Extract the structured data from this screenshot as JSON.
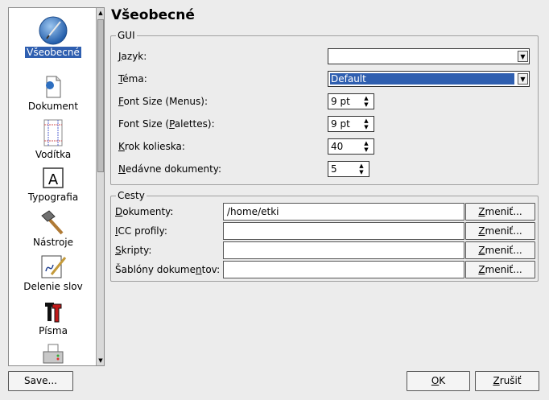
{
  "sidebar": {
    "items": [
      {
        "label": "Všeobecné",
        "icon": "globe-pen-icon"
      },
      {
        "label": "Dokument",
        "icon": "document-icon"
      },
      {
        "label": "Vodítka",
        "icon": "guides-icon"
      },
      {
        "label": "Typografia",
        "icon": "typography-icon"
      },
      {
        "label": "Nástroje",
        "icon": "hammer-icon"
      },
      {
        "label": "Delenie slov",
        "icon": "hyphenation-icon"
      },
      {
        "label": "Písma",
        "icon": "fonts-icon"
      },
      {
        "label": "",
        "icon": "printer-icon"
      }
    ]
  },
  "page": {
    "title": "Všeobecné"
  },
  "gui": {
    "legend": "GUI",
    "language": {
      "label_pre": "",
      "label_u": "J",
      "label_post": "azyk:",
      "value": ""
    },
    "theme": {
      "label_pre": "",
      "label_u": "T",
      "label_post": "éma:",
      "value": "Default"
    },
    "font_menus": {
      "label_pre": "",
      "label_u": "F",
      "label_post": "ont Size (Menus):",
      "value": "9 pt"
    },
    "font_palettes": {
      "label_pre": "Font Size (",
      "label_u": "P",
      "label_post": "alettes):",
      "value": "9 pt"
    },
    "wheel_step": {
      "label_pre": "",
      "label_u": "K",
      "label_post": "rok kolieska:",
      "value": "40"
    },
    "recent_docs": {
      "label_pre": "",
      "label_u": "N",
      "label_post": "edávne dokumenty:",
      "value": "5"
    }
  },
  "paths": {
    "legend": "Cesty",
    "rows": [
      {
        "label_pre": "",
        "label_u": "D",
        "label_post": "okumenty:",
        "value": "/home/etki"
      },
      {
        "label_pre": "",
        "label_u": "I",
        "label_post": "CC profily:",
        "value": ""
      },
      {
        "label_pre": "",
        "label_u": "S",
        "label_post": "kripty:",
        "value": ""
      },
      {
        "label_pre": "Šablóny dokume",
        "label_u": "n",
        "label_post": "tov:",
        "value": ""
      }
    ],
    "change_pre": "",
    "change_u": "Z",
    "change_post": "meniť..."
  },
  "footer": {
    "save": "Save...",
    "ok_u": "O",
    "ok_post": "K",
    "cancel_u": "Z",
    "cancel_post": "rušiť"
  }
}
